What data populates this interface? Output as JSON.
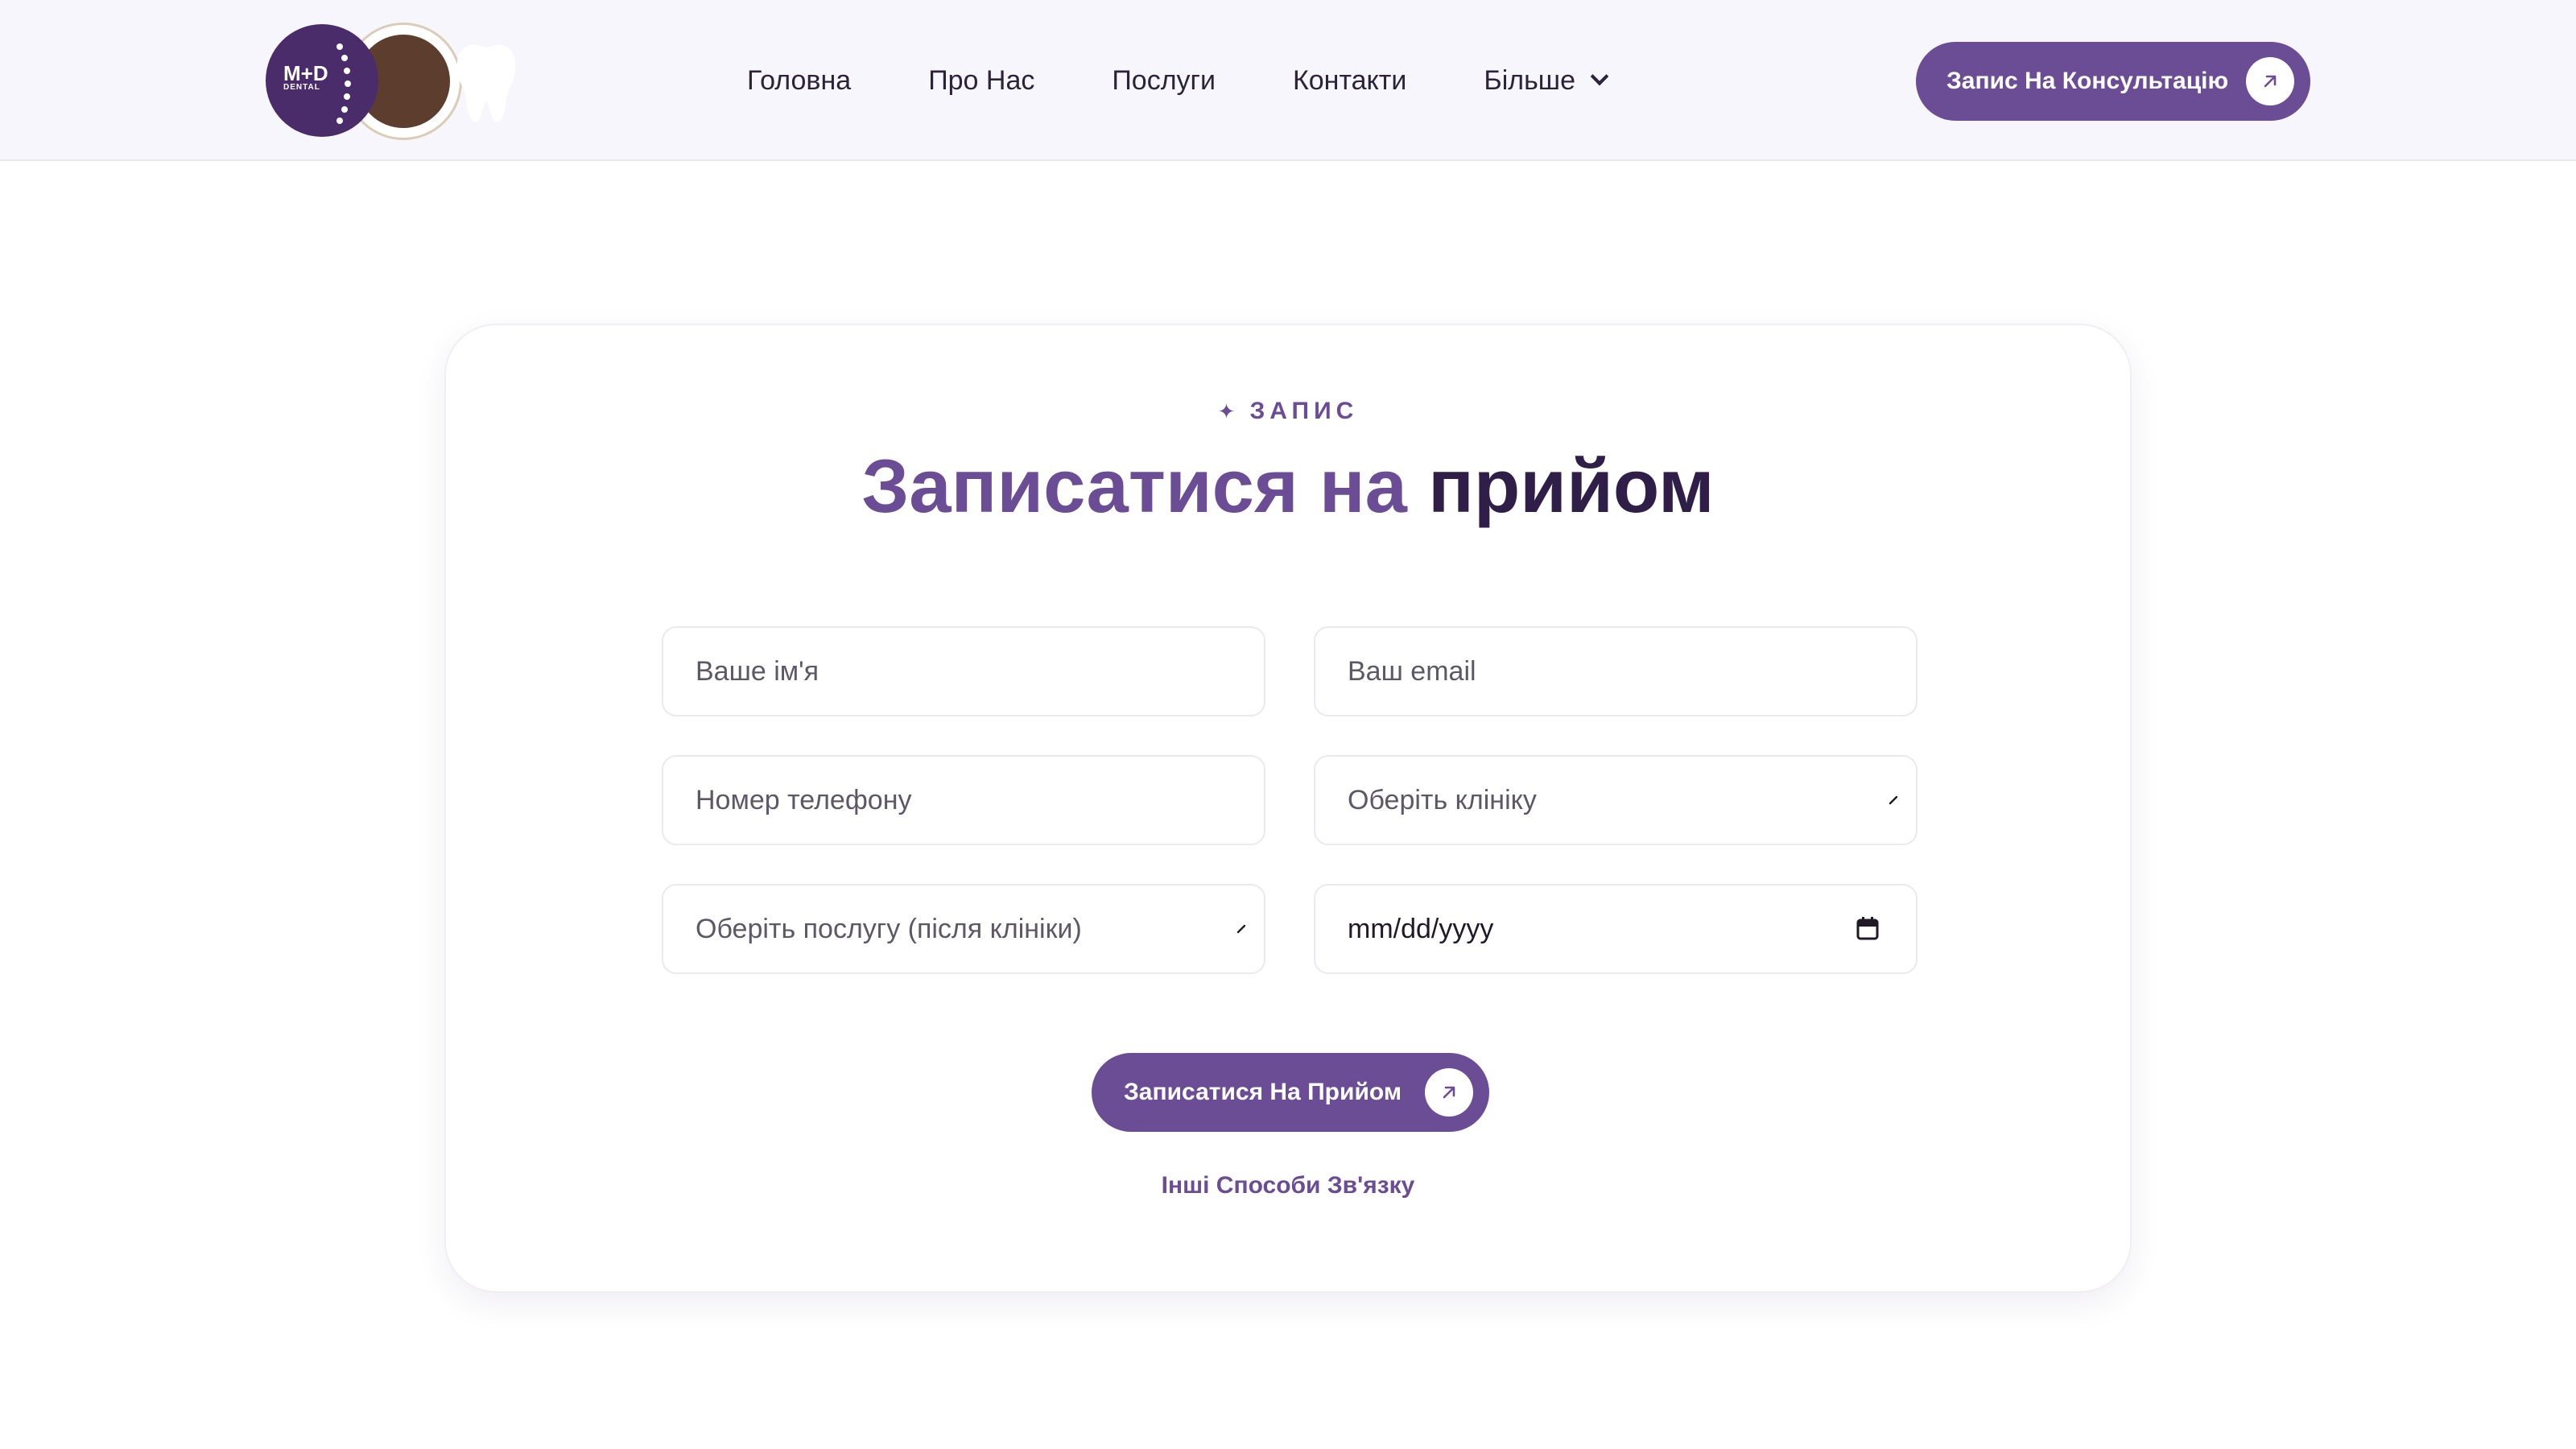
{
  "brand": {
    "logo_mark": "M+D",
    "logo_sub": "DENTAL",
    "accent": "#6a4d94",
    "dark": "#2f1e47",
    "header_bg": "#f8f6fd"
  },
  "nav": {
    "items": [
      {
        "label": "Головна"
      },
      {
        "label": "Про Нас"
      },
      {
        "label": "Послуги"
      },
      {
        "label": "Контакти"
      },
      {
        "label": "Більше",
        "icon": "chevron-down-icon"
      }
    ]
  },
  "header": {
    "cta_label": "Запис На Консультацію",
    "cta_icon": "arrow-up-right-icon"
  },
  "booking": {
    "eyebrow": "ЗАПИС",
    "eyebrow_icon": "sparkle-icon",
    "title_part1": "Записатися на",
    "title_part2": "прийом",
    "fields": {
      "name": {
        "placeholder": "Ваше ім'я"
      },
      "email": {
        "placeholder": "Ваш email"
      },
      "phone": {
        "placeholder": "Номер телефону"
      },
      "clinic": {
        "placeholder": "Оберіть клініку"
      },
      "service": {
        "placeholder": "Оберіть послугу (після клініки)"
      },
      "date": {
        "value": "mm/dd/yyyy",
        "icon": "calendar-icon"
      }
    },
    "submit_label": "Записатися На Прийом",
    "submit_icon": "arrow-up-right-icon",
    "other_link": "Інші Способи Зв'язку"
  }
}
